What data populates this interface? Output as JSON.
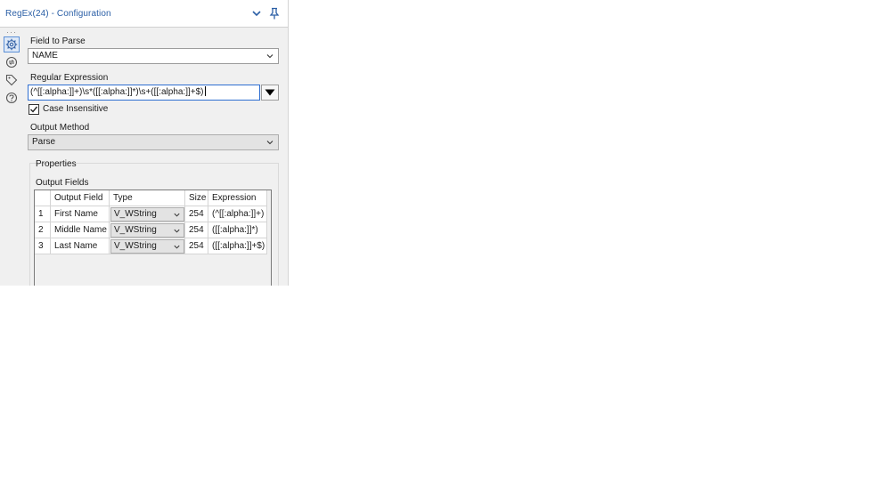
{
  "window": {
    "title": "RegEx(24) - Configuration"
  },
  "sidebar": {
    "icons": [
      "gear-icon",
      "connection-icon",
      "tag-icon",
      "help-icon"
    ]
  },
  "field_to_parse": {
    "label": "Field to Parse",
    "value": "NAME"
  },
  "regex": {
    "label": "Regular Expression",
    "value": "(^[[:alpha:]]+)\\s*([[:alpha:]]*)\\s+([[:alpha:]]+$)"
  },
  "case_insensitive": {
    "label": "Case Insensitive",
    "checked": true
  },
  "output_method": {
    "label": "Output Method",
    "value": "Parse"
  },
  "properties": {
    "label": "Properties",
    "output_fields_label": "Output Fields",
    "columns": [
      "Output Field",
      "Type",
      "Size",
      "Expression"
    ],
    "rows": [
      {
        "num": "1",
        "field": "First Name",
        "type": "V_WString",
        "size": "254",
        "expression": "(^[[:alpha:]]+)"
      },
      {
        "num": "2",
        "field": "Middle Name",
        "type": "V_WString",
        "size": "254",
        "expression": "([[:alpha:]]*)"
      },
      {
        "num": "3",
        "field": "Last Name",
        "type": "V_WString",
        "size": "254",
        "expression": "([[:alpha:]]+$)"
      }
    ]
  },
  "colors": {
    "title_text": "#2b5fa6",
    "accent": "#2f6fd1",
    "panel_bg": "#f0f0f0"
  }
}
